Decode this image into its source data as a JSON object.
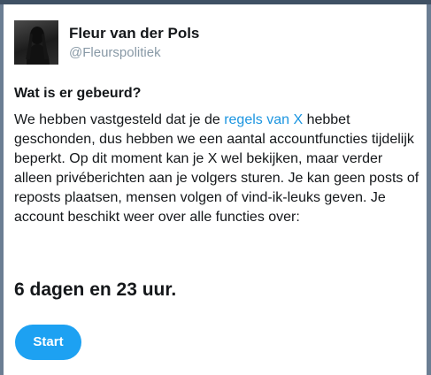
{
  "profile": {
    "display_name": "Fleur van der Pols",
    "handle": "@Fleurspolitiek"
  },
  "notice": {
    "heading": "Wat is er gebeurd?",
    "body_before_link": "We hebben vastgesteld dat je de ",
    "link_text": "regels van X",
    "body_after_link": " hebbet geschonden, dus hebben we een aantal accountfuncties tijdelijk beperkt. Op dit moment kan je X wel bekijken, maar verder alleen privéberichten aan je volgers sturen. Je kan geen posts of reposts plaatsen, mensen volgen of vind-ik-leuks geven. Je account beschikt weer over alle functies over:",
    "countdown": "6 dagen en 23 uur.",
    "start_label": "Start"
  },
  "colors": {
    "link": "#1b95e0",
    "button": "#1da1f2",
    "handle": "#8899a6",
    "text": "#14171a"
  },
  "icons": {
    "avatar": "profile-photo"
  }
}
